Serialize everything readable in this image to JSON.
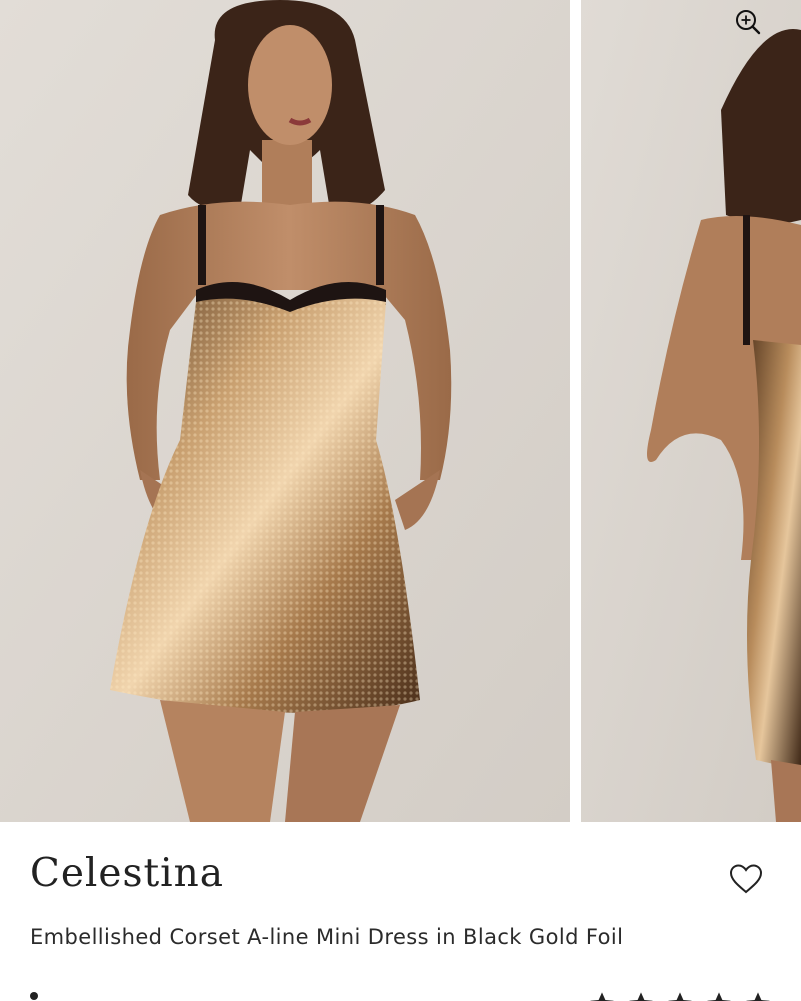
{
  "product": {
    "name": "Celestina",
    "description": "Embellished Corset A-line Mini Dress in Black Gold Foil"
  },
  "gallery": {
    "images": [
      {
        "alt": "front-view",
        "icon": "model-front-photo"
      },
      {
        "alt": "back-view",
        "icon": "model-back-photo"
      }
    ],
    "zoom_icon": "zoom-in-icon"
  },
  "wishlist": {
    "icon": "heart-icon"
  },
  "rating": {
    "icon": "star-icon",
    "stars": 5
  },
  "colors": {
    "background": "#ddd8d2",
    "text": "#222222",
    "dress_gold": "#b78a55"
  }
}
